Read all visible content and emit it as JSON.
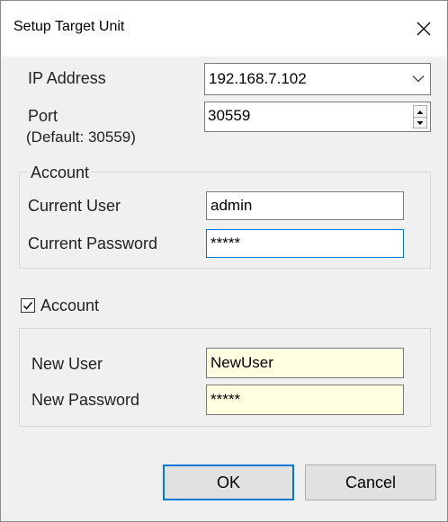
{
  "dialog": {
    "title": "Setup Target Unit",
    "close_icon": "close-icon"
  },
  "connection": {
    "ip_label": "IP Address",
    "ip_value": "192.168.7.102",
    "port_label": "Port",
    "port_hint": "(Default: 30559)",
    "port_value": "30559"
  },
  "current_account": {
    "legend": "Account",
    "user_label": "Current User",
    "user_value": "admin",
    "password_label": "Current Password",
    "password_value": "*****"
  },
  "new_account": {
    "checkbox_label": "Account",
    "checked": true,
    "user_label": "New User",
    "user_value": "NewUser",
    "password_label": "New Password",
    "password_value": "*****"
  },
  "buttons": {
    "ok": "OK",
    "cancel": "Cancel"
  },
  "colors": {
    "accent": "#0078d7",
    "field_highlight": "#ffffe1"
  }
}
